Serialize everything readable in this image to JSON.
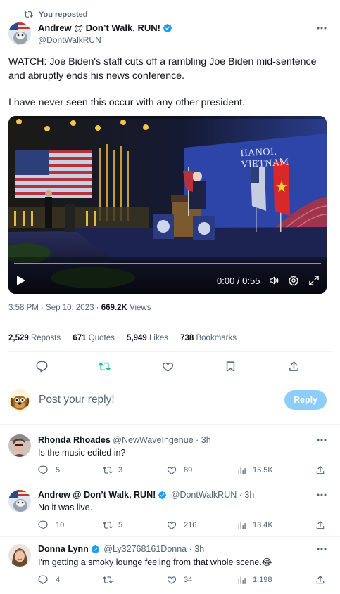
{
  "repost_banner": {
    "text": "You reposted"
  },
  "main_post": {
    "author_name": "Andrew @ Don’t Walk, RUN!",
    "handle": "@DontWalkRUN",
    "text_line1": "WATCH: Joe Biden's staff cuts off a rambling Joe Biden mid-sentence",
    "text_line2": "and abruptly ends his news conference.",
    "text_line3": "I have never seen this occur with any other president.",
    "video": {
      "backdrop_text": "HANOI, VIETNAM",
      "time": "0:00 / 0:55",
      "progress": 0.0
    },
    "timestamp": "3:58 PM · Sep 10, 2023 · ",
    "views_count": "669.2K",
    "views_label": " Views",
    "stats": {
      "reposts_count": "2,529",
      "reposts_label": "Reposts",
      "quotes_count": "671",
      "quotes_label": "Quotes",
      "likes_count": "5,949",
      "likes_label": "Likes",
      "bookmarks_count": "738",
      "bookmarks_label": "Bookmarks"
    }
  },
  "reply_box": {
    "placeholder": "Post your reply!",
    "button_label": "Reply"
  },
  "replies": [
    {
      "author_name": "Rhonda Rhoades",
      "handle_time": "@NewWaveIngenue · 3h",
      "text": "Is the music edited in?",
      "replies": "5",
      "reposts": "3",
      "likes": "89",
      "views": "15.5K"
    },
    {
      "author_name": "Andrew @ Don’t Walk, RUN!",
      "handle_time": "@DontWalkRUN · 3h",
      "text": "No it was live.",
      "replies": "10",
      "reposts": "5",
      "likes": "216",
      "views": "13.4K"
    },
    {
      "author_name": "Donna Lynn",
      "handle_time": "@Ly32768161Donna · 3h",
      "text": "I'm getting a smoky lounge feeling from that whole scene.😂",
      "replies": "4",
      "reposts": "",
      "likes": "34",
      "views": "1,198"
    }
  ],
  "colors": {
    "accent": "#1d9bf0",
    "repost_active": "#00ba7c",
    "muted": "#536471",
    "reply_button_disabled": "#8ecdf8"
  }
}
